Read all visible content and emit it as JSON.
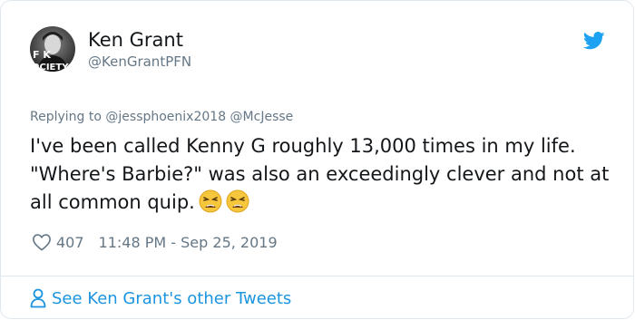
{
  "author": {
    "name": "Ken Grant",
    "handle": "@KenGrantPFN",
    "avatar_text_top": "F   K",
    "avatar_text_bottom": "OCIETY"
  },
  "reply_to": {
    "prefix": "Replying to",
    "mentions": "@jessphoenix2018 @McJesse"
  },
  "tweet": {
    "text": "I've been called Kenny G roughly 13,000 times in my life. \"Where's Barbie?\" was also an exceedingly clever and not at all common quip.",
    "emoji_count": 2
  },
  "meta": {
    "likes": "407",
    "timestamp": "11:48 PM - Sep 25, 2019"
  },
  "footer": {
    "link_label": "See Ken Grant's other Tweets"
  },
  "colors": {
    "link": "#1b95e0",
    "muted": "#657786",
    "text": "#14171a",
    "twitter_blue": "#1da1f2"
  },
  "icons": {
    "brand": "twitter-bird-icon",
    "like": "heart-icon",
    "profile": "person-icon",
    "emoji": "weary-face-emoji"
  }
}
